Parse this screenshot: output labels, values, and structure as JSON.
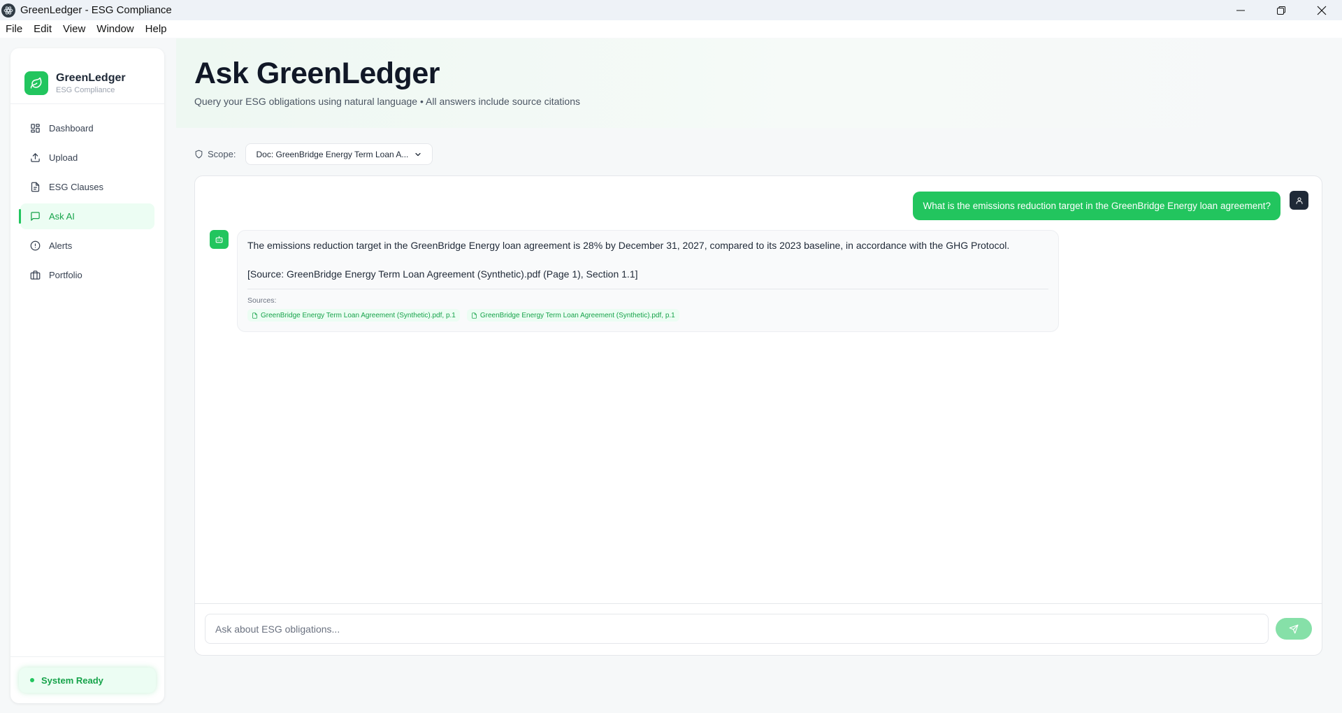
{
  "window": {
    "title": "GreenLedger - ESG Compliance"
  },
  "menubar": {
    "items": [
      "File",
      "Edit",
      "View",
      "Window",
      "Help"
    ]
  },
  "sidebar": {
    "brand_name": "GreenLedger",
    "brand_sub": "ESG Compliance",
    "items": [
      {
        "label": "Dashboard",
        "icon": "dashboard-icon"
      },
      {
        "label": "Upload",
        "icon": "upload-icon"
      },
      {
        "label": "ESG Clauses",
        "icon": "document-icon"
      },
      {
        "label": "Ask AI",
        "icon": "chat-icon",
        "active": true
      },
      {
        "label": "Alerts",
        "icon": "alert-icon"
      },
      {
        "label": "Portfolio",
        "icon": "briefcase-icon"
      }
    ],
    "status": "System Ready"
  },
  "header": {
    "title": "Ask GreenLedger",
    "subtitle": "Query your ESG obligations using natural language • All answers include source citations"
  },
  "scope": {
    "label": "Scope:",
    "selected": "Doc: GreenBridge Energy Term Loan A..."
  },
  "chat": {
    "user_message": "What is the emissions reduction target in the GreenBridge Energy loan agreement?",
    "bot_message": "The emissions reduction target in the GreenBridge Energy loan agreement is 28% by December 31, 2027, compared to its 2023 baseline, in accordance with the GHG Protocol.",
    "bot_citation": "[Source: GreenBridge Energy Term Loan Agreement (Synthetic).pdf (Page 1), Section 1.1]",
    "sources_label": "Sources:",
    "sources": [
      "GreenBridge Energy Term Loan Agreement (Synthetic).pdf, p.1",
      "GreenBridge Energy Term Loan Agreement (Synthetic).pdf, p.1"
    ]
  },
  "input": {
    "placeholder": "Ask about ESG obligations..."
  },
  "colors": {
    "accent": "#22c55e",
    "accent_text": "#16a34a",
    "accent_soft": "#ecfdf3"
  }
}
